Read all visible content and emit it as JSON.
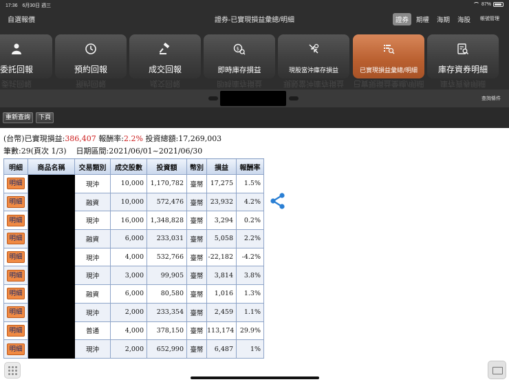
{
  "status_bar": {
    "time": "17:36",
    "date": "6月30日 週三",
    "battery": "87%"
  },
  "nav": {
    "back_label": "自選報價",
    "title": "證券-已實現損益彙總/明細",
    "tabs": [
      "證券",
      "期權",
      "海期",
      "海股"
    ],
    "active_tab": "證券",
    "account_mgmt": "帳號管理"
  },
  "menu_tiles": [
    {
      "label": "委託回報",
      "icon": "user-icon"
    },
    {
      "label": "預約回報",
      "icon": "clock-icon"
    },
    {
      "label": "成交回報",
      "icon": "gavel-icon"
    },
    {
      "label": "即時庫存損益",
      "icon": "money-search-icon"
    },
    {
      "label": "現股當沖庫存損益",
      "icon": "swap-icon"
    },
    {
      "label": "已實現損益彙總/明細",
      "icon": "list-search-icon",
      "active": true
    },
    {
      "label": "庫存資券明細",
      "icon": "doc-search-icon"
    }
  ],
  "query_conditions_label": "查詢條件",
  "toolbar": {
    "refresh_label": "重新查詢",
    "next_page_label": "下頁"
  },
  "summary": {
    "currency": "(台幣)",
    "realized_pl_label": "已實現損益:",
    "realized_pl": "386,407",
    "return_rate_label": "報酬率:",
    "return_rate": "2.2%",
    "total_investment_label": "投資總額:",
    "total_investment": "17,269,003",
    "count_label": "筆數:",
    "count": "29",
    "page_info": "(頁次 1/3)",
    "date_range_label": "日期區間:",
    "date_range": "2021/06/01~2021/06/30"
  },
  "table": {
    "headers": [
      "明細",
      "商品名稱",
      "交易類別",
      "成交股數",
      "投資額",
      "幣別",
      "損益",
      "報酬率"
    ],
    "detail_label": "明細",
    "rows": [
      {
        "type": "現沖",
        "shares": "10,000",
        "investment": "1,170,782",
        "currency": "臺幣",
        "pl": "17,275",
        "rate": "1.5%",
        "sign": "pos"
      },
      {
        "type": "融資",
        "shares": "10,000",
        "investment": "572,476",
        "currency": "臺幣",
        "pl": "23,932",
        "rate": "4.2%",
        "sign": "pos"
      },
      {
        "type": "現沖",
        "shares": "16,000",
        "investment": "1,348,828",
        "currency": "臺幣",
        "pl": "3,294",
        "rate": "0.2%",
        "sign": "pos"
      },
      {
        "type": "融資",
        "shares": "6,000",
        "investment": "233,031",
        "currency": "臺幣",
        "pl": "5,058",
        "rate": "2.2%",
        "sign": "pos"
      },
      {
        "type": "現沖",
        "shares": "4,000",
        "investment": "532,766",
        "currency": "臺幣",
        "pl": "-22,182",
        "rate": "-4.2%",
        "sign": "neg"
      },
      {
        "type": "現沖",
        "shares": "3,000",
        "investment": "99,905",
        "currency": "臺幣",
        "pl": "3,814",
        "rate": "3.8%",
        "sign": "pos"
      },
      {
        "type": "融資",
        "shares": "6,000",
        "investment": "80,580",
        "currency": "臺幣",
        "pl": "1,016",
        "rate": "1.3%",
        "sign": "pos"
      },
      {
        "type": "現沖",
        "shares": "2,000",
        "investment": "233,354",
        "currency": "臺幣",
        "pl": "2,459",
        "rate": "1.1%",
        "sign": "pos"
      },
      {
        "type": "普通",
        "shares": "4,000",
        "investment": "378,150",
        "currency": "臺幣",
        "pl": "113,174",
        "rate": "29.9%",
        "sign": "pos"
      },
      {
        "type": "現沖",
        "shares": "2,000",
        "investment": "652,990",
        "currency": "臺幣",
        "pl": "6,487",
        "rate": "1%",
        "sign": "pos"
      }
    ]
  },
  "colors": {
    "positive": "#cc1a1a",
    "negative": "#1a8a1a",
    "active_tile": "#b95f2f",
    "share": "#2a7fd4"
  }
}
